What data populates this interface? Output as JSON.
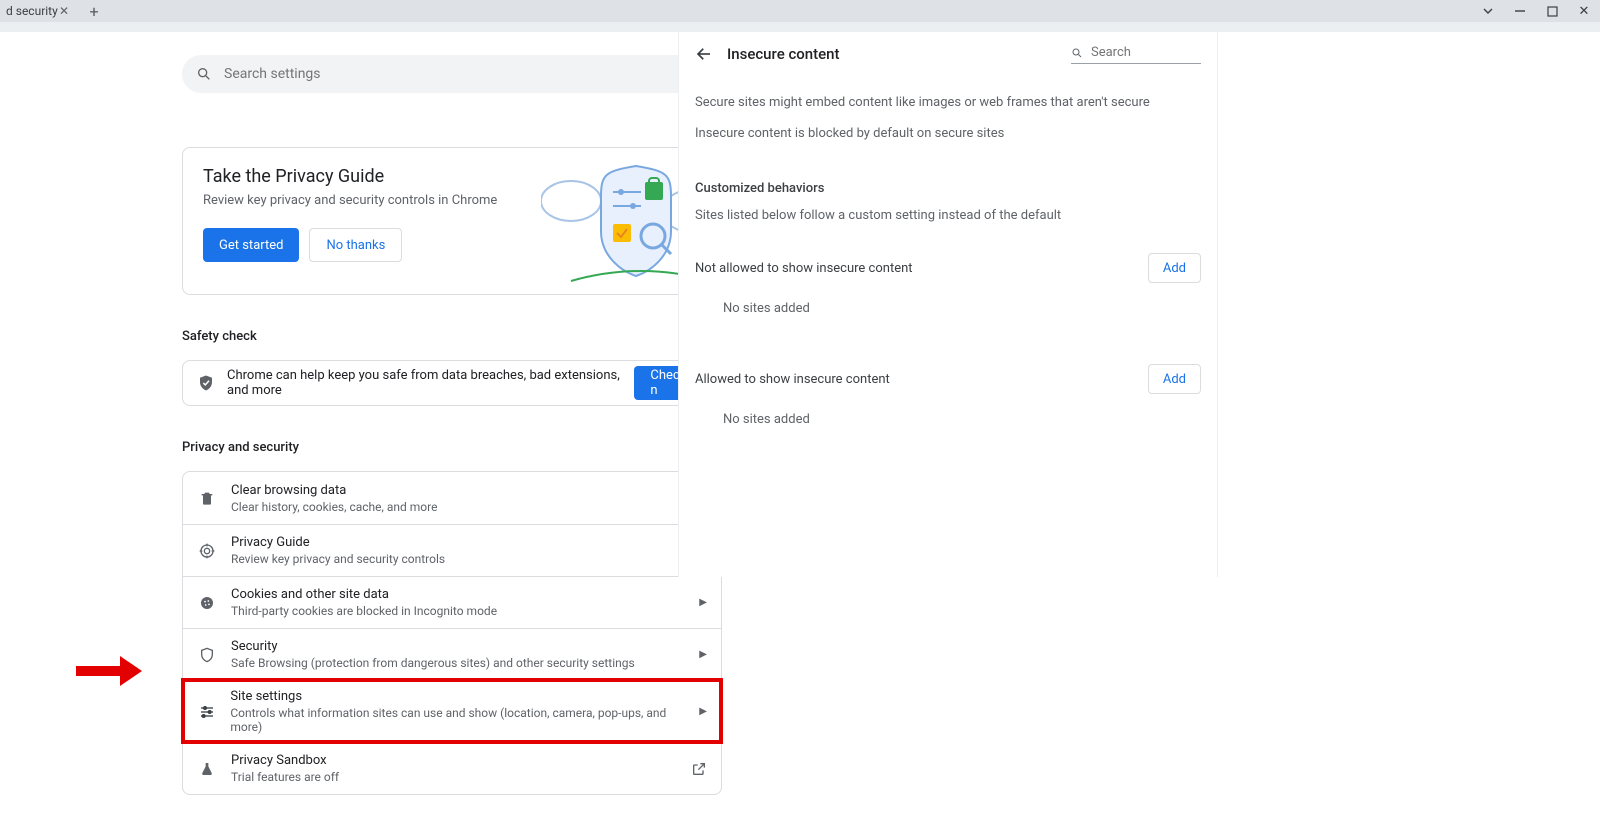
{
  "tab": {
    "title": "d security"
  },
  "search": {
    "placeholder": "Search settings"
  },
  "guide": {
    "title": "Take the Privacy Guide",
    "subtitle": "Review key privacy and security controls in Chrome",
    "get_started": "Get started",
    "no_thanks": "No thanks"
  },
  "safety": {
    "heading": "Safety check",
    "text": "Chrome can help keep you safe from data breaches, bad extensions, and more",
    "btn": "Check n"
  },
  "ps": {
    "heading": "Privacy and security",
    "rows": [
      {
        "icon": "trash",
        "t1": "Clear browsing data",
        "t2": "Clear history, cookies, cache, and more"
      },
      {
        "icon": "target",
        "t1": "Privacy Guide",
        "t2": "Review key privacy and security controls"
      },
      {
        "icon": "cookie",
        "t1": "Cookies and other site data",
        "t2": "Third-party cookies are blocked in Incognito mode"
      },
      {
        "icon": "shield",
        "t1": "Security",
        "t2": "Safe Browsing (protection from dangerous sites) and other security settings"
      },
      {
        "icon": "sliders",
        "t1": "Site settings",
        "t2": "Controls what information sites can use and show (location, camera, pop-ups, and more)"
      },
      {
        "icon": "flask",
        "t1": "Privacy Sandbox",
        "t2": "Trial features are off"
      }
    ]
  },
  "panel": {
    "title": "Insecure content",
    "search_placeholder": "Search",
    "desc1": "Secure sites might embed content like images or web frames that aren't secure",
    "desc2": "Insecure content is blocked by default on secure sites",
    "cust_heading": "Customized behaviors",
    "cust_desc": "Sites listed below follow a custom setting instead of the default",
    "not_allowed": "Not allowed to show insecure content",
    "allowed": "Allowed to show insecure content",
    "add": "Add",
    "empty": "No sites added"
  }
}
